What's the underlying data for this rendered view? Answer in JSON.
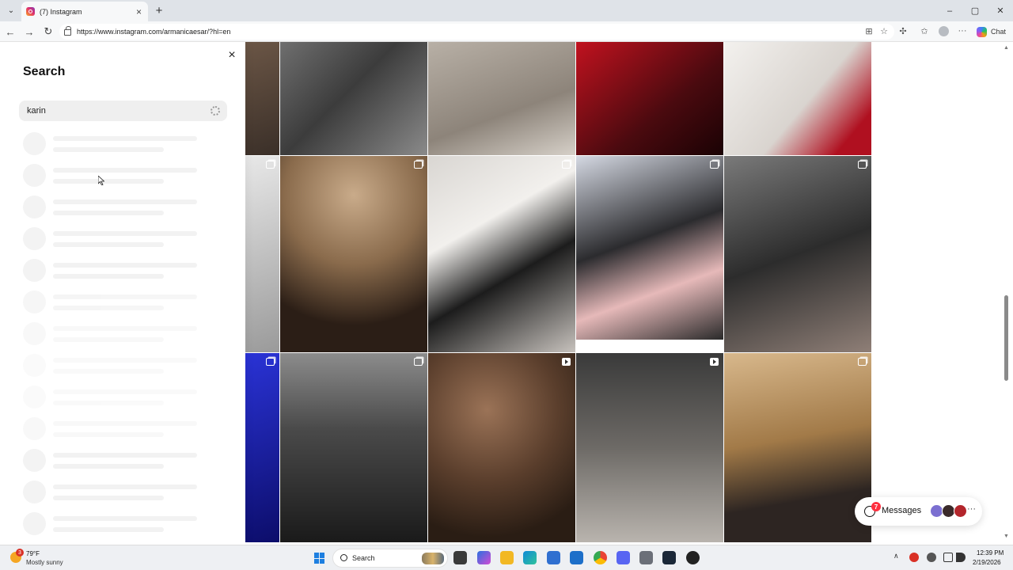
{
  "browser": {
    "tab": {
      "title": "(7) Instagram",
      "close": "×"
    },
    "new_tab": "+",
    "url": "https://www.instagram.com/armanicaesar/?hl=en",
    "copilot_label": "Chat",
    "window_controls": {
      "minimize": "–",
      "maximize": "▢",
      "close": "✕"
    }
  },
  "search_panel": {
    "heading": "Search",
    "query": "karin",
    "close": "×",
    "loading": true
  },
  "messages": {
    "label": "Messages",
    "unread_count": "7",
    "more": "···",
    "avatar_colors": [
      "#7b6fd1",
      "#3a2a2a",
      "#b3262c"
    ]
  },
  "taskbar": {
    "weather": {
      "temp": "79°F",
      "desc": "Mostly sunny",
      "badge": "3"
    },
    "search_label": "Search",
    "clock": {
      "time": "12:39 PM",
      "date": "2/19/2026"
    }
  },
  "colors": {
    "accent_blue": "#1d7fe0",
    "notification_red": "#ff3040"
  }
}
